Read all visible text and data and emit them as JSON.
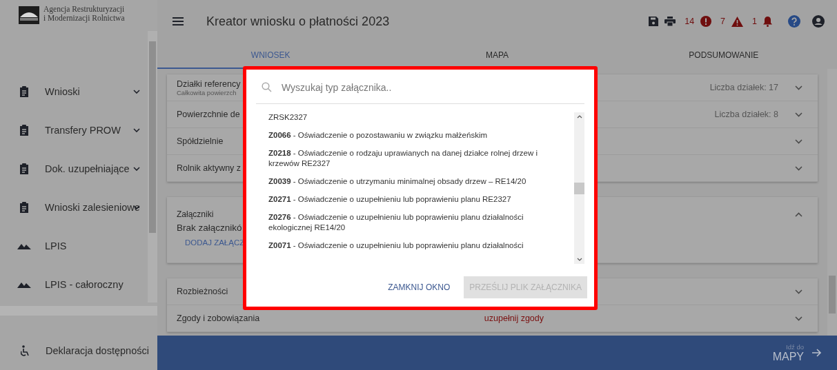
{
  "sidebar": {
    "logo_text": [
      "Agencja Restrukturyzacji",
      "i Modernizacji Rolnictwa"
    ],
    "items": [
      {
        "label": "Wnioski",
        "kind": "clipboard",
        "expandable": true
      },
      {
        "label": "Transfery PROW",
        "kind": "clipboard",
        "expandable": true
      },
      {
        "label": "Dok. uzupełniające",
        "kind": "clipboard",
        "expandable": true
      },
      {
        "label": "Wnioski zalesieniowe",
        "kind": "clipboard",
        "expandable": true
      },
      {
        "label": "LPIS",
        "kind": "mountain",
        "expandable": false
      },
      {
        "label": "LPIS - całoroczny",
        "kind": "mountain",
        "expandable": false
      }
    ],
    "footer_item": {
      "label": "Deklaracja dostępności",
      "kind": "accessibility"
    }
  },
  "header": {
    "title": "Kreator wniosku o płatności 2023",
    "counters": [
      {
        "count": "14",
        "kind": "error"
      },
      {
        "count": "7",
        "kind": "warning"
      },
      {
        "count": "1",
        "kind": "bell"
      }
    ]
  },
  "tabs": [
    {
      "label": "WNIOSEK",
      "selected": true
    },
    {
      "label": "MAPA",
      "selected": false
    },
    {
      "label": "PODSUMOWANIE",
      "selected": false
    }
  ],
  "sections": [
    {
      "rows": [
        {
          "title": "Działki referency",
          "subtitle": "Całkowita powierzch",
          "info": "Liczba działek: 17",
          "expanded": false
        },
        {
          "title": "Powierzchnie de",
          "info": "Liczba działek: 8",
          "expanded": false
        },
        {
          "title": "Spółdzielnie",
          "expanded": false
        },
        {
          "title": "Rolnik aktywny z",
          "expanded": false
        }
      ]
    },
    {
      "rows": [
        {
          "title": "Załączniki",
          "body": "Brak załącznikó",
          "action": "DODAJ ZAŁĄCZ",
          "expanded": true
        }
      ]
    },
    {
      "rows": [
        {
          "title": "Rozbieżności",
          "expanded": false
        },
        {
          "title": "Zgody i zobowiązania",
          "warning": "uzupełnij zgody",
          "expanded": false
        }
      ]
    }
  ],
  "footer_bar": {
    "hint": "Idź do",
    "target": "MAPY"
  },
  "dialog": {
    "search": {
      "placeholder": "Wyszukaj typ załącznika.."
    },
    "items": [
      "ZRSK2327",
      "**Z0066** - Oświadczenie o pozostawaniu w związku małżeńskim",
      "**Z0218** - Oświadczenie o rodzaju uprawianych na danej działce rolnej drzew i krzewów RE2327",
      "**Z0039** - Oświadczenie o utrzymaniu minimalnej obsady drzew – RE14/20",
      "**Z0271** - Oświadczenie o uzupełnieniu lub poprawieniu planu RE2327",
      "**Z0276** - Oświadczenie o uzupełnieniu lub poprawieniu planu działalności ekologicznej RE14/20",
      "**Z0071** - Oświadczenie o uzupełnieniu lub poprawieniu planu działalności"
    ],
    "buttons": [
      {
        "label": "ZAMKNIJ OKNO",
        "disabled": false
      },
      {
        "label": "PRZEŚLIJ PLIK ZAŁĄCZNIKA",
        "disabled": true
      }
    ]
  }
}
